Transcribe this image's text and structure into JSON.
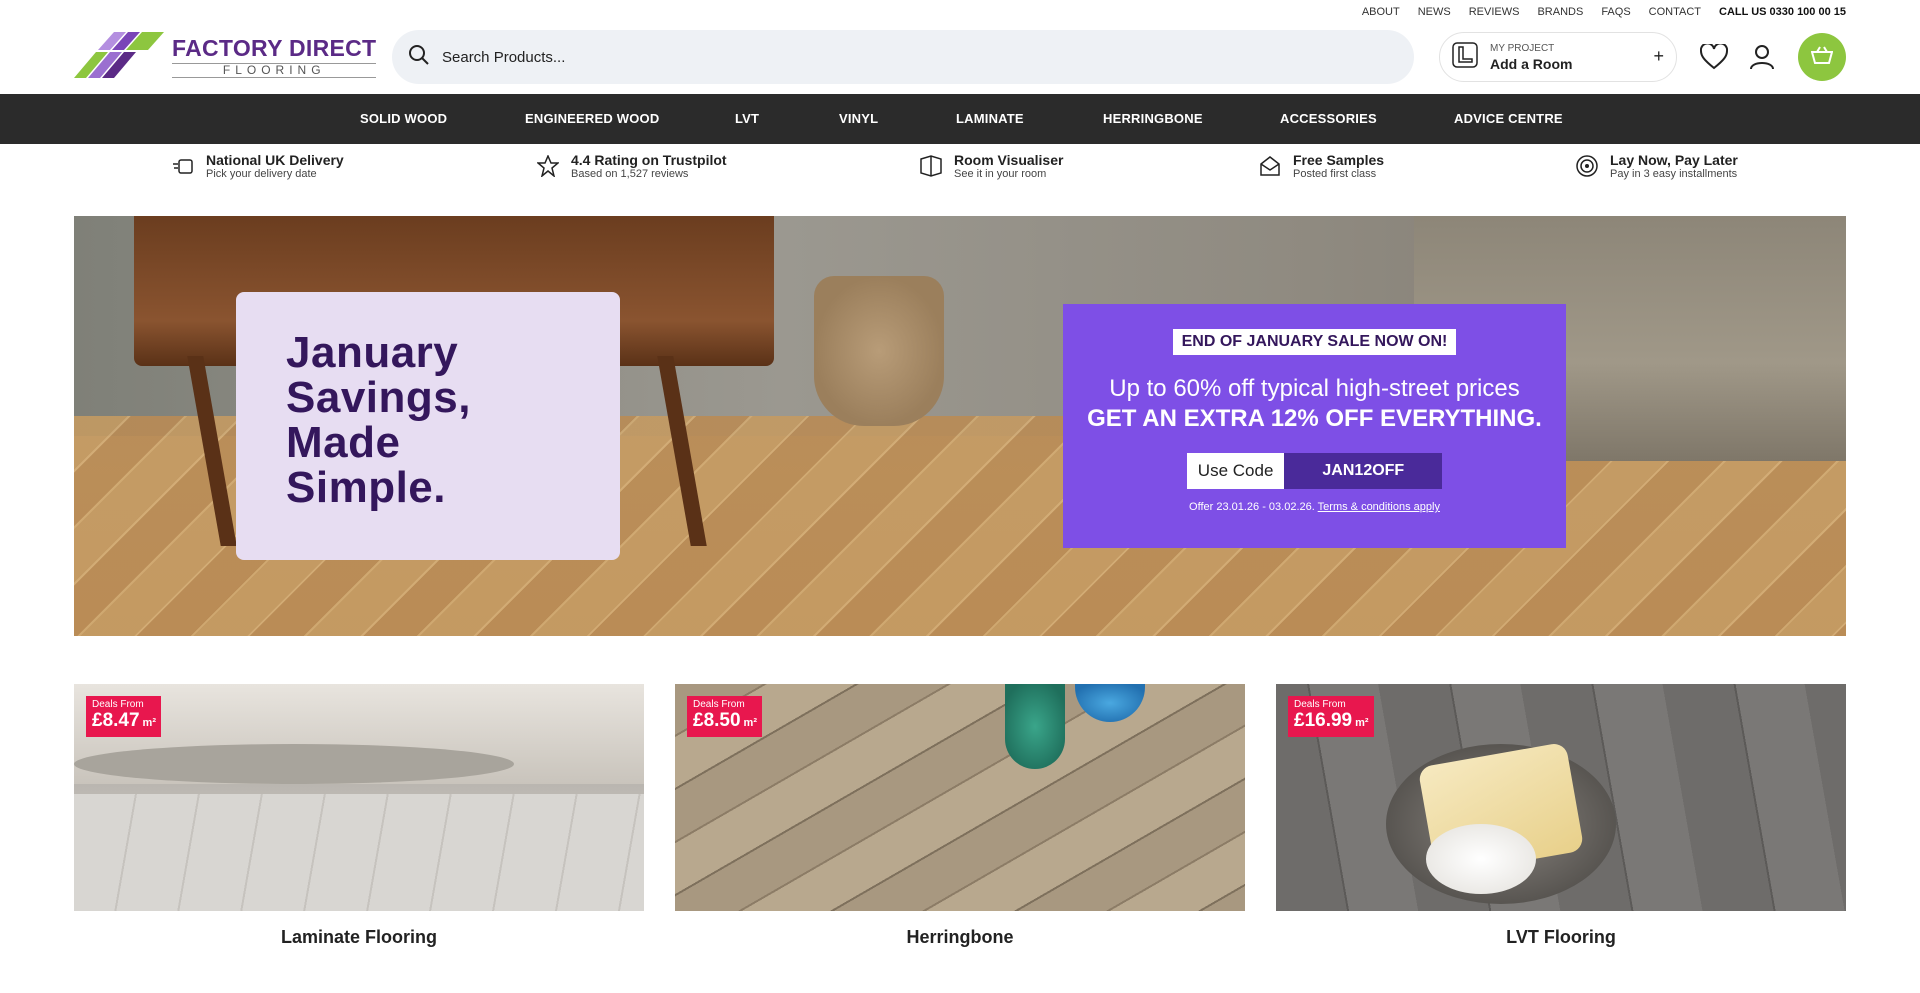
{
  "utility_links": [
    "ABOUT",
    "NEWS",
    "REVIEWS",
    "BRANDS",
    "FAQS",
    "CONTACT"
  ],
  "utility_call": "CALL US 0330 100 00 15",
  "logo": {
    "line1": "FACTORY DIRECT",
    "line2": "FLOORING"
  },
  "search": {
    "placeholder": "Search Products..."
  },
  "project": {
    "label": "MY PROJECT",
    "action": "Add a Room",
    "plus": "+"
  },
  "nav": [
    "SOLID WOOD",
    "ENGINEERED WOOD",
    "LVT",
    "VINYL",
    "LAMINATE",
    "HERRINGBONE",
    "ACCESSORIES",
    "ADVICE CENTRE"
  ],
  "usps": [
    {
      "title": "National UK Delivery",
      "sub": "Pick your delivery date",
      "icon": "delivery-icon"
    },
    {
      "title": "4.4 Rating on Trustpilot",
      "sub": "Based on 1,527 reviews",
      "icon": "star-icon"
    },
    {
      "title": "Room Visualiser",
      "sub": "See it in your room",
      "icon": "room-icon"
    },
    {
      "title": "Free Samples",
      "sub": "Posted first class",
      "icon": "samples-icon"
    },
    {
      "title": "Lay Now, Pay Later",
      "sub": "Pay in 3 easy installments",
      "icon": "pay-later-icon"
    }
  ],
  "hero": {
    "headline": "January Savings, Made Simple.",
    "badge": "END OF JANUARY SALE NOW ON!",
    "line1": "Up to 60% off typical high-street prices",
    "line2": "GET AN EXTRA 12% OFF EVERYTHING.",
    "use_code": "Use Code",
    "code": "JAN12OFF",
    "offer_dates": "Offer 23.01.26 - 03.02.26.",
    "terms": "Terms & conditions apply"
  },
  "categories": [
    {
      "name": "Laminate Flooring",
      "deal_label": "Deals From",
      "price": "£8.47",
      "unit": "m²"
    },
    {
      "name": "Herringbone",
      "deal_label": "Deals From",
      "price": "£8.50",
      "unit": "m²"
    },
    {
      "name": "LVT Flooring",
      "deal_label": "Deals From",
      "price": "£16.99",
      "unit": "m²"
    }
  ],
  "colors": {
    "brand_purple": "#5b2a86",
    "brand_green": "#8dc63f",
    "promo_purple": "#7e4fe6",
    "deal_red": "#e8174e",
    "nav_dark": "#2b2b2b"
  }
}
